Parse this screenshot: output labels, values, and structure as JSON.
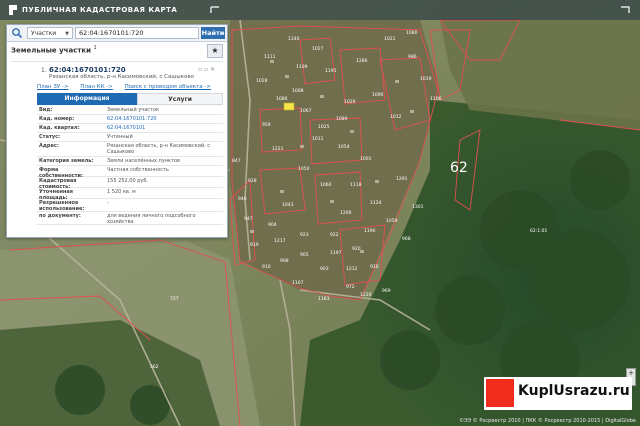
{
  "header": {
    "title": "ПУБЛИЧНАЯ КАДАСТРОВАЯ КАРТА"
  },
  "search": {
    "scope": "Участки",
    "query": "62:04:1670101:720",
    "find_label": "Найти"
  },
  "results": {
    "header": "Земельные участки",
    "count": "1"
  },
  "result": {
    "index": "1.",
    "cad_number": "62:04:1670101:720",
    "address_short": "Рязанская область, р-н Касимовский, с Сашыково",
    "links": [
      "План ЗУ ->",
      "План КК ->",
      "Поиск с проводом объекта ->"
    ],
    "tabs": {
      "info": "Информация",
      "services": "Услуги"
    }
  },
  "info": [
    {
      "label": "Вид:",
      "value": "Земельный участок",
      "link": false
    },
    {
      "label": "Кад. номер:",
      "value": "62:04:1670101:720",
      "link": true
    },
    {
      "label": "Кад. квартал:",
      "value": "62:04:1670101",
      "link": true
    },
    {
      "label": "Статус:",
      "value": "Учтенный",
      "link": false
    },
    {
      "label": "Адрес:",
      "value": "Рязанская область, р-н Касимовский, с Сашыково",
      "link": false
    },
    {
      "label": "Категория земель:",
      "value": "Земли населённых пунктов",
      "link": false
    },
    {
      "label": "Форма собственности:",
      "value": "Частная собственность",
      "link": false
    },
    {
      "label": "Кадастровая стоимость:",
      "value": "155 252,00 руб.",
      "link": false
    },
    {
      "label": "Уточненная площадь:",
      "value": "1 520 кв. м",
      "link": false
    },
    {
      "label": "Разрешенное использование:",
      "value": "-",
      "link": false
    },
    {
      "label": "по документу:",
      "value": "для ведения личного подсобного хозяйства",
      "link": false
    }
  ],
  "map": {
    "region_label": "62",
    "labels": [
      "727",
      "562",
      "1029",
      "1291",
      "1301",
      "1109",
      "1195",
      "1286",
      "1090",
      "1012",
      "1008",
      "1025",
      "1054",
      "1001",
      "959",
      "1221",
      "1050",
      "1060",
      "1043",
      "1200",
      "904",
      "919",
      "923",
      "922",
      "920",
      "916",
      "903",
      "905",
      "908",
      "910",
      "847",
      "928",
      "946",
      "947",
      "968",
      "969",
      "972",
      "986",
      "1019",
      "1106",
      "1021",
      "1080",
      "1027",
      "1140",
      "1111",
      "1028",
      "1086",
      "1067",
      "1011",
      "1089",
      "1118",
      "1124",
      "1059",
      "1190",
      "1197",
      "1212",
      "1220",
      "1183",
      "1167",
      "1217",
      "62:1:01"
    ],
    "zoom_plus": "+",
    "zoom_minus": "-",
    "copyright": "©ЭЭ © Росреестр 2010 | ПКК © Росреестр 2010-2015 | DigitalGlobe"
  },
  "watermark": {
    "text": "KuplUsrazu.ru"
  }
}
